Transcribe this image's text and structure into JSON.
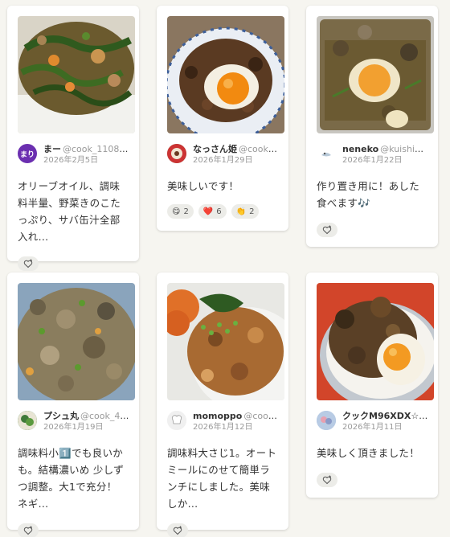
{
  "colors": {
    "background": "#f6f5f0",
    "card": "#ffffff",
    "muted_text": "#999999",
    "chip": "#ecece8"
  },
  "reports": [
    {
      "author": "まー",
      "handle": "@cook_110801...",
      "date": "2026年2月5日",
      "avatar_text": "まり",
      "avatar_color": "#6b2fb0",
      "comment": "オリーブオイル、調味料半量、野菜きのこたっぷり、サバ缶汁全部入れ...",
      "reactions": []
    },
    {
      "author": "なっさん姫",
      "handle": "@cook_4...",
      "date": "2026年1月29日",
      "avatar_text": "",
      "avatar_color": "#8a5a3a",
      "comment": "美味しいです！",
      "reactions": [
        {
          "emoji": "😋",
          "count": "2"
        },
        {
          "emoji": "❤️",
          "count": "6"
        },
        {
          "emoji": "👏",
          "count": "2"
        }
      ]
    },
    {
      "author": "neneko",
      "handle": "@kuishinbo_",
      "date": "2026年1月22日",
      "avatar_text": "",
      "avatar_color": "#ffffff",
      "comment": "作り置き用に！あした食べます🎶",
      "reactions": []
    },
    {
      "author": "プシュ丸",
      "handle": "@cook_41...",
      "date": "2026年1月19日",
      "avatar_text": "",
      "avatar_color": "#3f7a3a",
      "comment": "調味料小1️⃣でも良いかも。結構濃いめ 少しずつ調整。大1で充分！ ネギ...",
      "reactions": []
    },
    {
      "author": "momoppo",
      "handle": "@cook_4...",
      "date": "2026年1月12日",
      "avatar_text": "",
      "avatar_color": "#eeeeee",
      "comment": "調味料大さじ1。オートミールにのせて簡単ランチにしました。美味しか...",
      "reactions": []
    },
    {
      "author": "クックM96XDX☆",
      "handle": "@...",
      "date": "2026年1月11日",
      "avatar_text": "",
      "avatar_color": "#9db8d8",
      "comment": "美味しく頂きました！",
      "reactions": []
    }
  ]
}
